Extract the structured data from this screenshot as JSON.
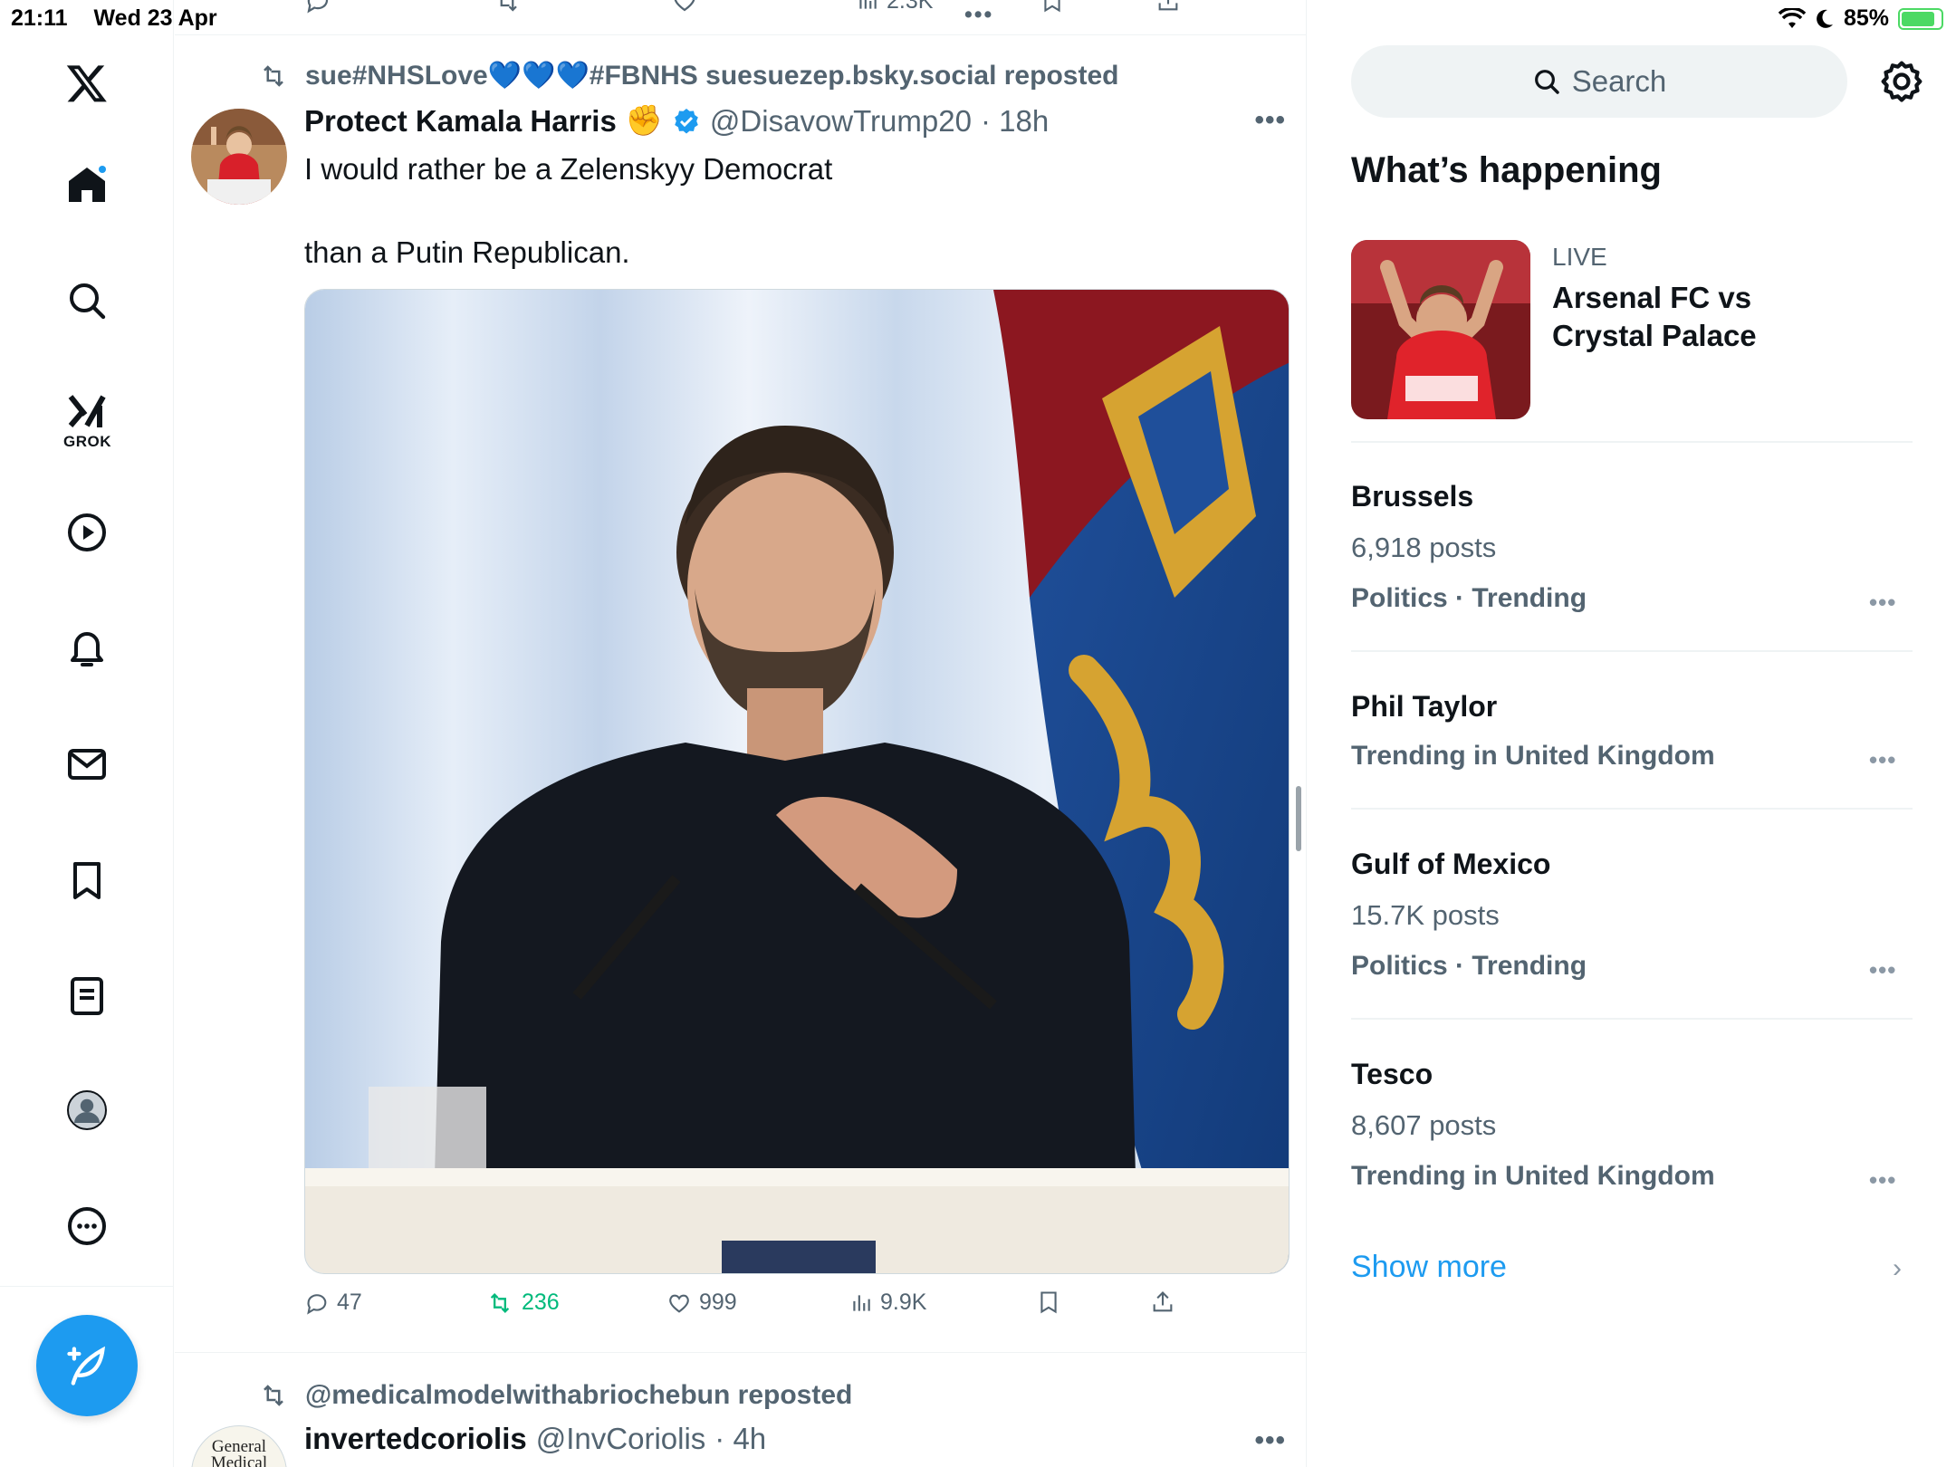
{
  "status_bar": {
    "time": "21:11",
    "date": "Wed 23 Apr",
    "battery": "85%"
  },
  "nav": {
    "grok_label": "GROK",
    "items": [
      "home",
      "explore",
      "grok",
      "video",
      "notifications",
      "messages",
      "bookmarks",
      "lists",
      "profile",
      "more"
    ]
  },
  "prev_tweet": {
    "views": "2.3K"
  },
  "tweet1": {
    "repost_by": "sue#NHSLove💙💙💙#FBNHS suesuezep.bsky.social reposted",
    "author_name": "Protect Kamala Harris",
    "author_emoji": "✊",
    "handle": "@DisavowTrump20",
    "time": "· 18h",
    "text_line1": "I would rather be a Zelenskyy Democrat",
    "text_line2": "than a Putin Republican.",
    "replies": "47",
    "reposts": "236",
    "likes": "999",
    "views": "9.9K"
  },
  "tweet2": {
    "repost_by": "@medicalmodelwithabriochebun reposted",
    "author_name": "invertedcoriolis",
    "handle": "@InvCoriolis",
    "time": "· 4h",
    "avatar_text1": "General",
    "avatar_text2": "Medical"
  },
  "sidebar": {
    "search_placeholder": "Search",
    "section_title": "What’s happening",
    "live": {
      "label": "LIVE",
      "title": "Arsenal FC vs Crystal Palace"
    },
    "trends": [
      {
        "name": "Brussels",
        "count": "6,918 posts",
        "meta": "Politics · Trending"
      },
      {
        "name": "Phil Taylor",
        "count": "",
        "meta": "Trending in United Kingdom"
      },
      {
        "name": "Gulf of Mexico",
        "count": "15.7K posts",
        "meta": "Politics · Trending"
      },
      {
        "name": "Tesco",
        "count": "8,607 posts",
        "meta": "Trending in United Kingdom"
      }
    ],
    "show_more": "Show more"
  },
  "colors": {
    "accent": "#1d9bf0",
    "repost_green": "#00ba7c",
    "secondary_text": "#536471"
  }
}
